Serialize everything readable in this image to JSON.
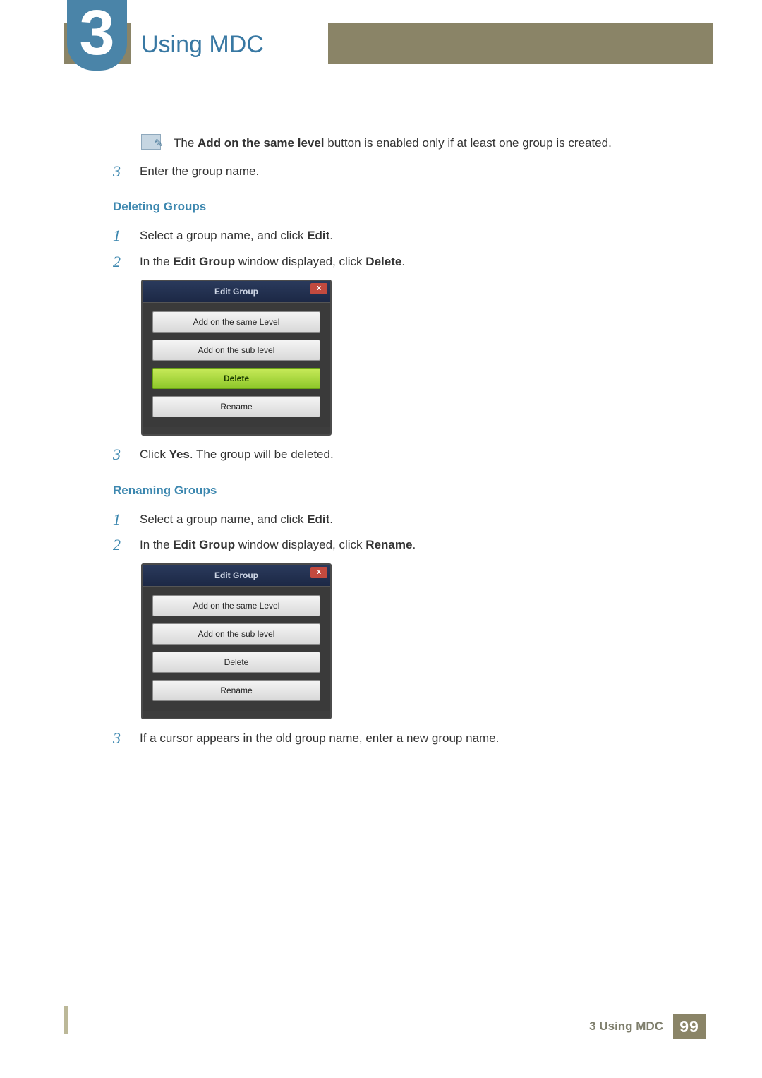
{
  "chapter": {
    "number": "3",
    "title": "Using MDC"
  },
  "note": {
    "text_pre": "The ",
    "bold": "Add on the same level",
    "text_post": " button is enabled only if at least one group is created."
  },
  "step3a": {
    "num": "3",
    "text": "Enter the group name."
  },
  "sec_delete": {
    "heading": "Deleting Groups",
    "s1": {
      "num": "1",
      "pre": "Select a group name, and click ",
      "bold": "Edit",
      "post": "."
    },
    "s2": {
      "num": "2",
      "pre": "In the ",
      "b1": "Edit Group",
      "mid": " window displayed, click ",
      "b2": "Delete",
      "post": "."
    },
    "s3": {
      "num": "3",
      "pre": "Click ",
      "bold": "Yes",
      "post": ". The group will be deleted."
    }
  },
  "dialog1": {
    "title": "Edit Group",
    "close": "x",
    "btn1": "Add on the same Level",
    "btn2": "Add on the sub level",
    "btn3": "Delete",
    "btn4": "Rename"
  },
  "sec_rename": {
    "heading": "Renaming Groups",
    "s1": {
      "num": "1",
      "pre": "Select a group name, and click ",
      "bold": "Edit",
      "post": "."
    },
    "s2": {
      "num": "2",
      "pre": "In the ",
      "b1": "Edit Group",
      "mid": " window displayed, click ",
      "b2": "Rename",
      "post": "."
    },
    "s3": {
      "num": "3",
      "text": "If a cursor appears in the old group name, enter a new group name."
    }
  },
  "dialog2": {
    "title": "Edit Group",
    "close": "x",
    "btn1": "Add on the same Level",
    "btn2": "Add on the sub level",
    "btn3": "Delete",
    "btn4": "Rename"
  },
  "footer": {
    "label": "3 Using MDC",
    "page": "99"
  }
}
